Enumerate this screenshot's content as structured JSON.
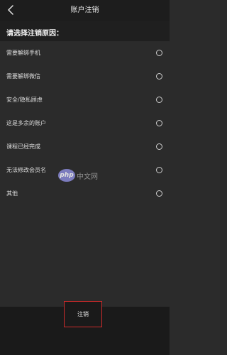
{
  "header": {
    "title": "账户注销",
    "back_icon": "chevron-left-icon"
  },
  "prompt": "请选择注销原因：",
  "options": [
    {
      "label": "需要解绑手机",
      "selected": false
    },
    {
      "label": "需要解绑微信",
      "selected": false
    },
    {
      "label": "安全/隐私顾虑",
      "selected": false
    },
    {
      "label": "这是多余的账户",
      "selected": false
    },
    {
      "label": "课程已经完成",
      "selected": false
    },
    {
      "label": "无法修改会员名",
      "selected": false
    },
    {
      "label": "其他",
      "selected": false
    }
  ],
  "watermark": {
    "logo_text": "php",
    "text": "中文网"
  },
  "footer": {
    "submit_label": "注销",
    "highlight_color": "#cc2b2b"
  }
}
